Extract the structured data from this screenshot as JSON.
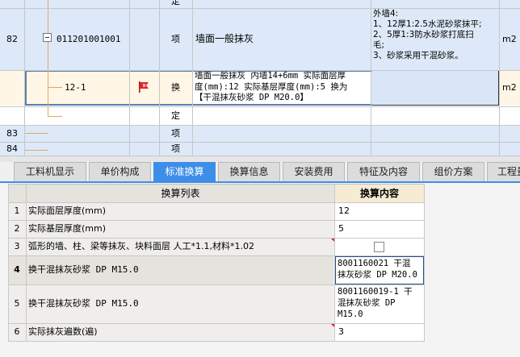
{
  "colors": {
    "accent": "#3d8ee8",
    "row_selected": "#fff6e6",
    "row_blue": "#dde9f8",
    "flag": "#e0222b"
  },
  "upper": {
    "partial_top": {
      "dept": "定"
    },
    "row82": {
      "num": "82",
      "code": "011201001001",
      "type": "项",
      "name": "墙面一般抹灰",
      "feature_lines": [
        "外墙4:",
        "1、12厚1:2.5水泥砂浆抹平;",
        "2、5厚1:3防水砂浆打底扫",
        "毛;",
        "3、砂浆采用干混砂浆。"
      ],
      "unit": "m2"
    },
    "row_sel": {
      "code": "12-1",
      "type": "换",
      "name_lines": [
        "墙面一般抹灰 内墙14+6mm  实际面层厚",
        "度(mm):12  实际基层厚度(mm):5  换为",
        "【干混抹灰砂浆 DP M20.0】"
      ],
      "unit": "m2"
    },
    "row_ding": {
      "type": "定"
    },
    "row83": {
      "num": "83",
      "type": "项"
    },
    "row84": {
      "num": "84",
      "type": "项"
    }
  },
  "tabs": [
    "工料机显示",
    "单价构成",
    "标准换算",
    "换算信息",
    "安装费用",
    "特征及内容",
    "组价方案",
    "工程量"
  ],
  "active_tab": "标准换算",
  "lower": {
    "headers": {
      "list": "换算列表",
      "content": "换算内容"
    },
    "rows": [
      {
        "num": "1",
        "label": "实际面层厚度(mm)",
        "value": "12"
      },
      {
        "num": "2",
        "label": "实际基层厚度(mm)",
        "value": "5"
      },
      {
        "num": "3",
        "label": "弧形的墙、柱、梁等抹灰、块料面层 人工*1.1,材料*1.02",
        "value": ""
      },
      {
        "num": "4",
        "label": "换干混抹灰砂浆 DP M15.0",
        "value_lines": [
          "8001160021  干混",
          "抹灰砂浆 DP M20.0"
        ]
      },
      {
        "num": "5",
        "label": "换干混抹灰砂浆 DP M15.0",
        "value_lines": [
          "8001160019-1  干",
          "混抹灰砂浆 DP",
          "M15.0"
        ]
      },
      {
        "num": "6",
        "label": "实际抹灰遍数(遍)",
        "value": "3"
      }
    ]
  }
}
